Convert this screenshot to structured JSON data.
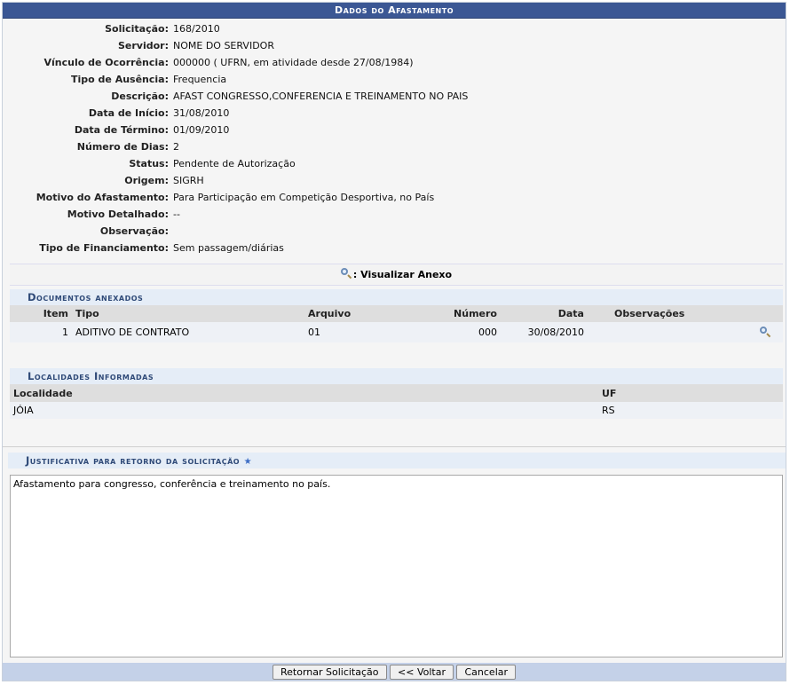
{
  "caption": "Dados do Afastamento",
  "details": [
    {
      "label": "Solicitação:",
      "value": "168/2010"
    },
    {
      "label": "Servidor:",
      "value": "NOME DO SERVIDOR"
    },
    {
      "label": "Vínculo de Ocorrência:",
      "value": "000000 ( UFRN, em atividade desde 27/08/1984)"
    },
    {
      "label": "Tipo de Ausência:",
      "value": "Frequencia"
    },
    {
      "label": "Descrição:",
      "value": "AFAST CONGRESSO,CONFERENCIA E TREINAMENTO NO PAIS"
    },
    {
      "label": "Data de Início:",
      "value": "31/08/2010"
    },
    {
      "label": "Data de Término:",
      "value": "01/09/2010"
    },
    {
      "label": "Número de Dias:",
      "value": "2"
    },
    {
      "label": "Status:",
      "value": "Pendente de Autorização"
    },
    {
      "label": "Origem:",
      "value": "SIGRH"
    },
    {
      "label": "Motivo do Afastamento:",
      "value": "Para Participação em Competição Desportiva, no País"
    },
    {
      "label": "Motivo Detalhado:",
      "value": "--"
    },
    {
      "label": "Observação:",
      "value": ""
    },
    {
      "label": "Tipo de Financiamento:",
      "value": "Sem passagem/diárias"
    }
  ],
  "anexo_link": ": Visualizar Anexo",
  "documentos": {
    "title": "Documentos anexados",
    "headers": {
      "item": "Item",
      "tipo": "Tipo",
      "arquivo": "Arquivo",
      "numero": "Número",
      "data": "Data",
      "observacoes": "Observações"
    },
    "rows": [
      {
        "item": "1",
        "tipo": "ADITIVO DE CONTRATO",
        "arquivo": "01",
        "numero": "000",
        "data": "30/08/2010",
        "observacoes": ""
      }
    ]
  },
  "localidades": {
    "title": "Localidades Informadas",
    "headers": {
      "localidade": "Localidade",
      "uf": "UF"
    },
    "rows": [
      {
        "localidade": "JÓIA",
        "uf": "RS"
      }
    ]
  },
  "justificativa": {
    "title": "Justificativa para retorno da solicitação",
    "required_mark": "★",
    "text": "Afastamento para congresso, conferência e treinamento no país."
  },
  "buttons": {
    "retornar": "Retornar Solicitação",
    "voltar": "<< Voltar",
    "cancelar": "Cancelar"
  }
}
